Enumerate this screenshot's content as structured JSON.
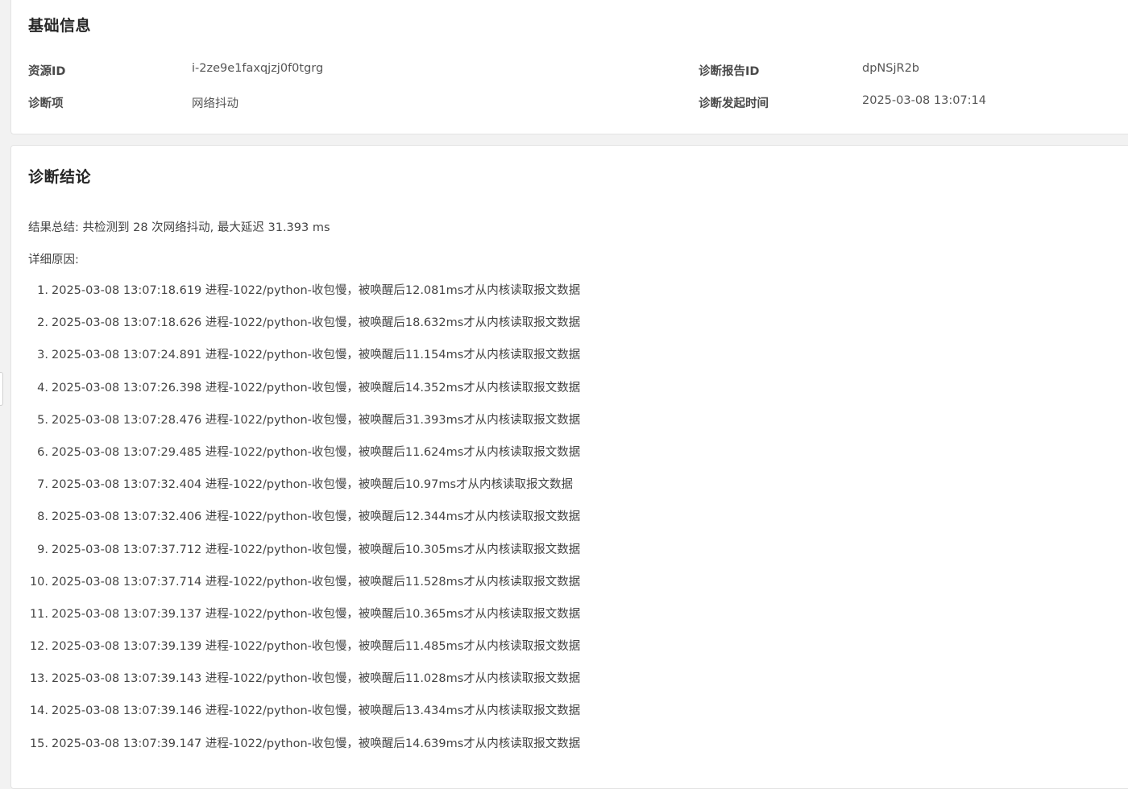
{
  "basic_info": {
    "title": "基础信息",
    "resource_id_label": "资源ID",
    "resource_id_value": "i-2ze9e1faxqjzj0f0tgrg",
    "report_id_label": "诊断报告ID",
    "report_id_value": "dpNSjR2b",
    "item_label": "诊断项",
    "item_value": "网络抖动",
    "time_label": "诊断发起时间",
    "time_value": "2025-03-08 13:07:14"
  },
  "conclusion": {
    "title": "诊断结论",
    "summary": "结果总结: 共检测到 28 次网络抖动, 最大延迟 31.393 ms",
    "detail_label": "详细原因:",
    "reasons": [
      {
        "num": "1.",
        "text": "2025-03-08 13:07:18.619 进程-1022/python-收包慢，被唤醒后12.081ms才从内核读取报文数据"
      },
      {
        "num": "2.",
        "text": "2025-03-08 13:07:18.626 进程-1022/python-收包慢，被唤醒后18.632ms才从内核读取报文数据"
      },
      {
        "num": "3.",
        "text": "2025-03-08 13:07:24.891 进程-1022/python-收包慢，被唤醒后11.154ms才从内核读取报文数据"
      },
      {
        "num": "4.",
        "text": "2025-03-08 13:07:26.398 进程-1022/python-收包慢，被唤醒后14.352ms才从内核读取报文数据"
      },
      {
        "num": "5.",
        "text": "2025-03-08 13:07:28.476 进程-1022/python-收包慢，被唤醒后31.393ms才从内核读取报文数据"
      },
      {
        "num": "6.",
        "text": "2025-03-08 13:07:29.485 进程-1022/python-收包慢，被唤醒后11.624ms才从内核读取报文数据"
      },
      {
        "num": "7.",
        "text": "2025-03-08 13:07:32.404 进程-1022/python-收包慢，被唤醒后10.97ms才从内核读取报文数据"
      },
      {
        "num": "8.",
        "text": "2025-03-08 13:07:32.406 进程-1022/python-收包慢，被唤醒后12.344ms才从内核读取报文数据"
      },
      {
        "num": "9.",
        "text": "2025-03-08 13:07:37.712 进程-1022/python-收包慢，被唤醒后10.305ms才从内核读取报文数据"
      },
      {
        "num": "10.",
        "text": "2025-03-08 13:07:37.714 进程-1022/python-收包慢，被唤醒后11.528ms才从内核读取报文数据"
      },
      {
        "num": "11.",
        "text": "2025-03-08 13:07:39.137 进程-1022/python-收包慢，被唤醒后10.365ms才从内核读取报文数据"
      },
      {
        "num": "12.",
        "text": "2025-03-08 13:07:39.139 进程-1022/python-收包慢，被唤醒后11.485ms才从内核读取报文数据"
      },
      {
        "num": "13.",
        "text": "2025-03-08 13:07:39.143 进程-1022/python-收包慢，被唤醒后11.028ms才从内核读取报文数据"
      },
      {
        "num": "14.",
        "text": "2025-03-08 13:07:39.146 进程-1022/python-收包慢，被唤醒后13.434ms才从内核读取报文数据"
      },
      {
        "num": "15.",
        "text": "2025-03-08 13:07:39.147 进程-1022/python-收包慢，被唤醒后14.639ms才从内核读取报文数据"
      }
    ]
  }
}
